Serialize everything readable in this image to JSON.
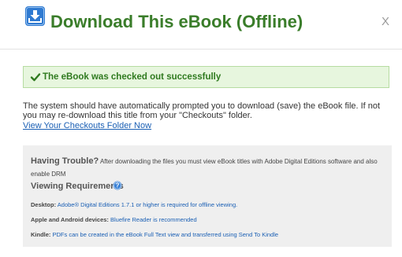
{
  "header": {
    "title": "Download This eBook (Offline)",
    "close_label": "X",
    "icon": "download-icon"
  },
  "success": {
    "message": "The eBook was checked out successfully",
    "icon": "checkmark-icon"
  },
  "body": {
    "text": "The system should have automatically prompted you to download (save) the eBook file. If not you may re-download this title from your \"Checkouts\" folder.",
    "link": "View Your Checkouts Folder Now"
  },
  "panel": {
    "trouble_title": "Having Trouble?",
    "trouble_text": "After downloading the files you must view eBook titles with Adobe Digital Editions software and also enable DRM",
    "viewing_title": "Viewing Requirements",
    "help_icon": "help-icon",
    "requirements": [
      {
        "label": "Desktop:",
        "text": "Adobe® Digital Editions 1.7.1 or higher is required for offline viewing."
      },
      {
        "label": "Apple and Android devices:",
        "text": "Bluefire Reader is recommended"
      },
      {
        "label": "Kindle:",
        "text": "PDFs can be created in the eBook Full Text view and transferred using Send To Kindle"
      }
    ]
  },
  "colors": {
    "title_green": "#3a7d2a",
    "success_bg": "#e7f6de",
    "success_border": "#b6dca1",
    "link_blue": "#1a5fb4",
    "panel_bg": "#efefef"
  }
}
